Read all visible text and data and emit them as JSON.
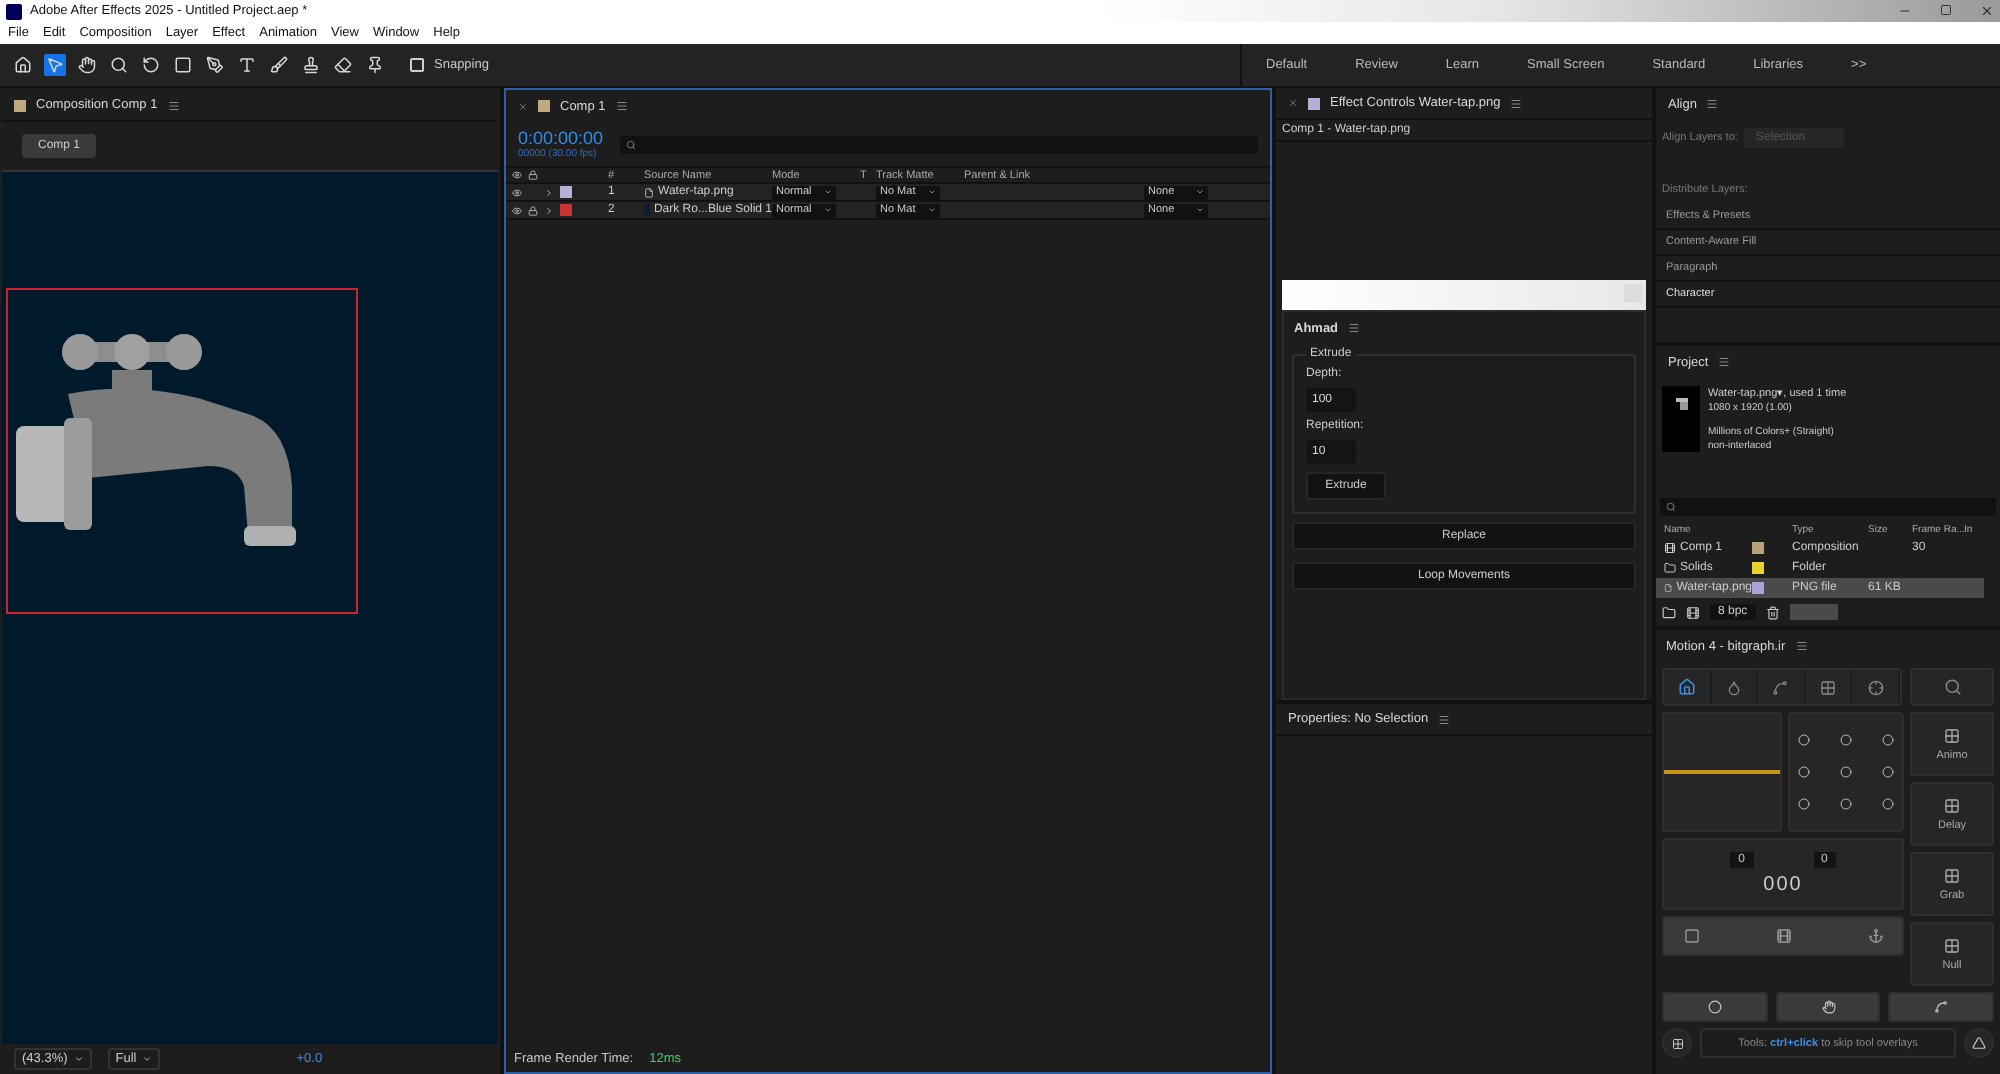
{
  "window": {
    "title": "Adobe After Effects 2025 - Untitled Project.aep *"
  },
  "menu": [
    "File",
    "Edit",
    "Composition",
    "Layer",
    "Effect",
    "Animation",
    "View",
    "Window",
    "Help"
  ],
  "toolbar": {
    "snapping": {
      "label": "Snapping",
      "checked": false
    }
  },
  "workspaces": [
    "Default",
    "Review",
    "Learn",
    "Small Screen",
    "Standard",
    "Libraries",
    ">>"
  ],
  "composition_panel": {
    "title": "Composition Comp 1",
    "tab": "Comp 1",
    "zoom": "(43.3%)",
    "resolution": "Full",
    "exposure": "+0.0"
  },
  "timeline": {
    "tab": "Comp 1",
    "timecode": "0:00:00:00",
    "frame_info": "00000 (30.00 fps)",
    "columns": [
      "#",
      "Source Name",
      "Mode",
      "T",
      "Track Matte",
      "Parent & Link"
    ],
    "layers": [
      {
        "number": "1",
        "name": "Water-tap.png",
        "color": "#b4b0d8",
        "mode": "Normal",
        "matte": "No Mat",
        "parent": "None",
        "locked": false,
        "kind": "file"
      },
      {
        "number": "2",
        "name": "Dark Ro...Blue Solid 1",
        "color": "#c83232",
        "mode": "Normal",
        "matte": "No Mat",
        "parent": "None",
        "locked": true,
        "kind": "solid"
      }
    ],
    "render_time_label": "Frame Render Time:",
    "render_time": "12ms"
  },
  "effect_controls": {
    "title": "Effect Controls Water-tap.png",
    "subtitle": "Comp 1 - Water-tap.png"
  },
  "script_panel": {
    "title": "Ahmad",
    "group": "Extrude",
    "fields": [
      {
        "label": "Depth:",
        "value": "100"
      },
      {
        "label": "Repetition:",
        "value": "10"
      }
    ],
    "extrude_button": "Extrude",
    "buttons": [
      "Replace",
      "Loop Movements"
    ]
  },
  "properties": {
    "title": "Properties: No Selection"
  },
  "align": {
    "title": "Align",
    "align_to_label": "Align Layers to:",
    "align_to": "Selection",
    "distribute_label": "Distribute Layers:"
  },
  "collapsed_panels": [
    "Effects & Presets",
    "Content-Aware Fill",
    "Paragraph",
    "Character"
  ],
  "project": {
    "title": "Project",
    "file_name": "Water-tap.png▾",
    "usage": ", used 1 time",
    "dimensions": "1080 x 1920 (1.00)",
    "colors": "Millions of Colors+ (Straight)",
    "interlace": "non-interlaced",
    "columns": [
      "Name",
      "Type",
      "Size",
      "Frame Ra...",
      "In"
    ],
    "items": [
      {
        "kind": "comp",
        "name": "Comp 1",
        "color": "#b8a27c",
        "type": "Composition",
        "frame_rate": "30",
        "selected": false
      },
      {
        "kind": "folder",
        "name": "Solids",
        "color": "#e6d22a",
        "type": "Folder",
        "selected": false
      },
      {
        "kind": "file",
        "name": "Water-tap.png",
        "color": "#a8a4d8",
        "type": "PNG file",
        "size": "61 KB",
        "selected": true
      }
    ],
    "bit_depth": "8 bpc"
  },
  "motion": {
    "title": "Motion 4 - bitgraph.ir",
    "left_value": "0",
    "right_value": "0",
    "counter": "000",
    "side_buttons": [
      "Animo",
      "Delay",
      "Grab",
      "Null"
    ],
    "hint_prefix": "Tools:",
    "hint_key": "ctrl+click",
    "hint_suffix": "to skip tool overlays"
  }
}
